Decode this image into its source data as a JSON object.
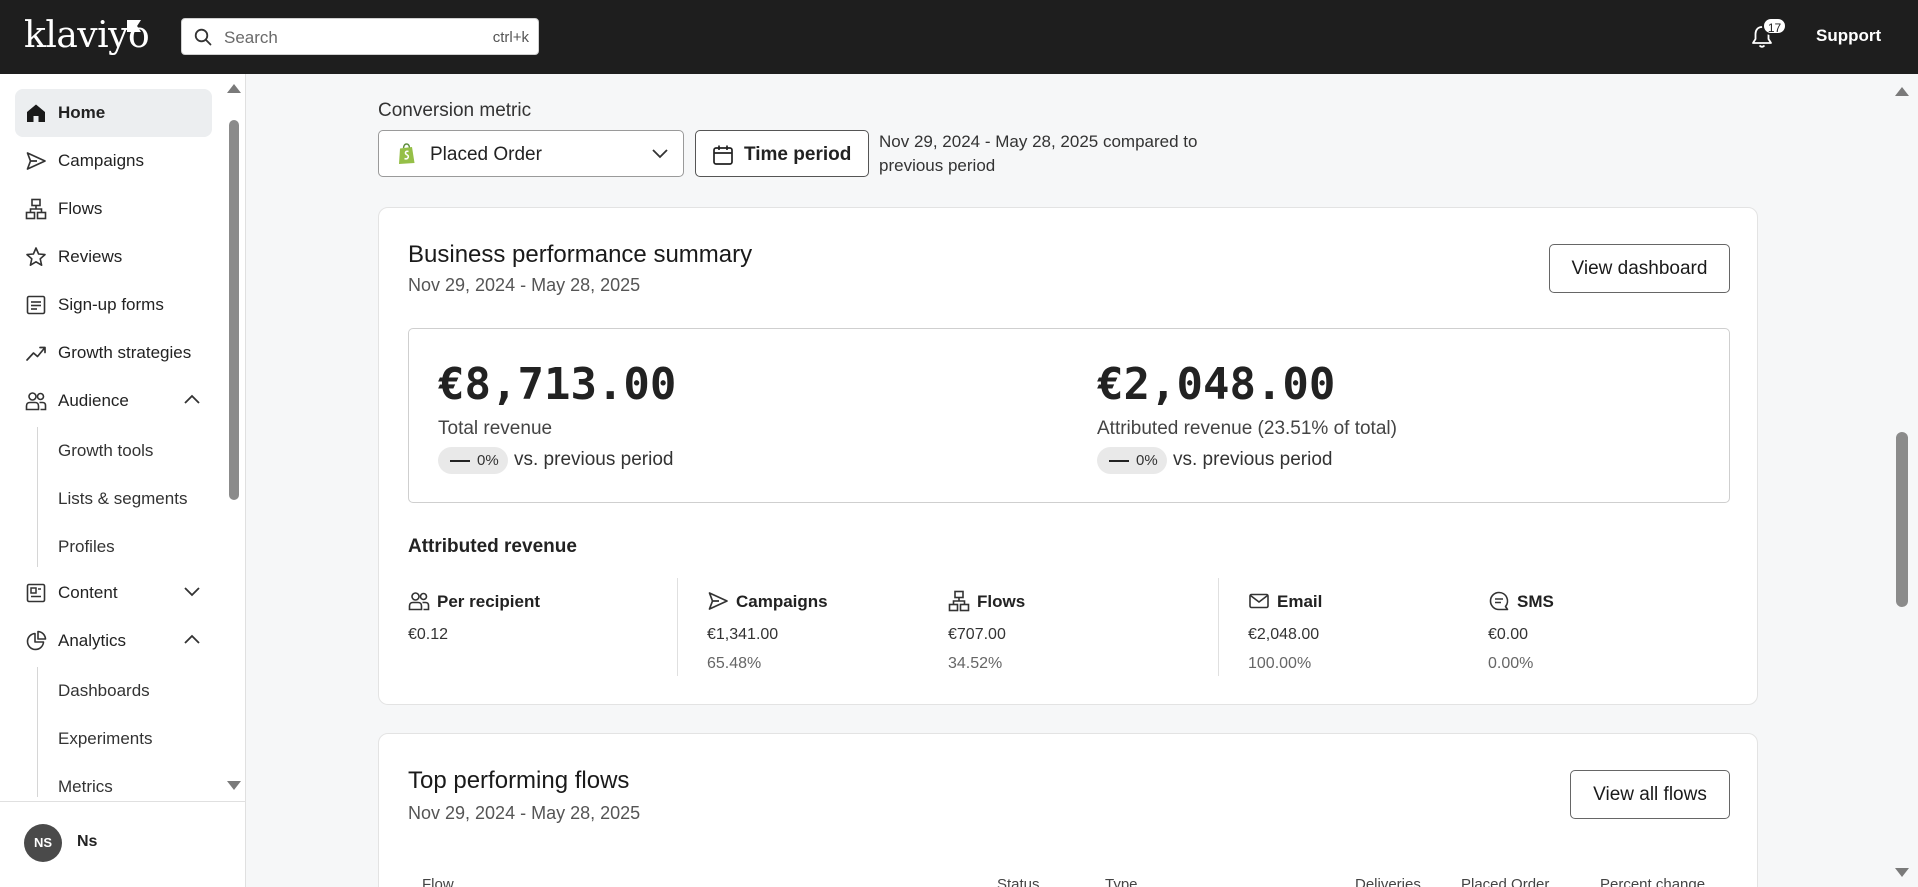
{
  "app": {
    "logo": "klaviyo",
    "search_placeholder": "Search",
    "search_shortcut": "ctrl+k",
    "notification_count": "17",
    "support": "Support"
  },
  "sidebar": {
    "items": [
      {
        "label": "Home",
        "icon": "home-icon",
        "active": true
      },
      {
        "label": "Campaigns",
        "icon": "send-icon"
      },
      {
        "label": "Flows",
        "icon": "flow-icon"
      },
      {
        "label": "Reviews",
        "icon": "star-icon"
      },
      {
        "label": "Sign-up forms",
        "icon": "form-icon"
      },
      {
        "label": "Growth strategies",
        "icon": "trend-icon"
      },
      {
        "label": "Audience",
        "icon": "people-icon",
        "expanded": true
      },
      {
        "label": "Content",
        "icon": "content-icon",
        "expanded": false
      },
      {
        "label": "Analytics",
        "icon": "pie-chart-icon",
        "expanded": true
      }
    ],
    "audience_sub": [
      "Growth tools",
      "Lists & segments",
      "Profiles"
    ],
    "analytics_sub": [
      "Dashboards",
      "Experiments",
      "Metrics"
    ],
    "user": {
      "initials": "NS",
      "name": "Ns"
    }
  },
  "filters": {
    "conversion_metric_label": "Conversion metric",
    "metric_value": "Placed Order",
    "time_period_label": "Time period",
    "period_text": "Nov 29, 2024 - May 28, 2025 compared to previous period"
  },
  "summary": {
    "title": "Business performance summary",
    "date_range": "Nov 29, 2024 - May 28, 2025",
    "view_button": "View dashboard",
    "total_revenue": {
      "value": "€8,713.00",
      "label": "Total revenue",
      "change": "0%",
      "vs": "vs. previous period"
    },
    "attributed_revenue": {
      "value": "€2,048.00",
      "label": "Attributed revenue (23.51% of total)",
      "change": "0%",
      "vs": "vs. previous period"
    },
    "attributed_title": "Attributed revenue",
    "stats": [
      {
        "name": "Per recipient",
        "icon": "people-icon",
        "value": "€0.12",
        "pct": ""
      },
      {
        "name": "Campaigns",
        "icon": "send-icon",
        "value": "€1,341.00",
        "pct": "65.48%"
      },
      {
        "name": "Flows",
        "icon": "flow-icon",
        "value": "€707.00",
        "pct": "34.52%"
      },
      {
        "name": "Email",
        "icon": "mail-icon",
        "value": "€2,048.00",
        "pct": "100.00%"
      },
      {
        "name": "SMS",
        "icon": "chat-icon",
        "value": "€0.00",
        "pct": "0.00%"
      }
    ]
  },
  "flows": {
    "title": "Top performing flows",
    "date_range": "Nov 29, 2024 - May 28, 2025",
    "view_button": "View all flows",
    "columns": [
      "Flow",
      "Status",
      "Type",
      "Deliveries",
      "Placed Order",
      "Percent change"
    ]
  }
}
